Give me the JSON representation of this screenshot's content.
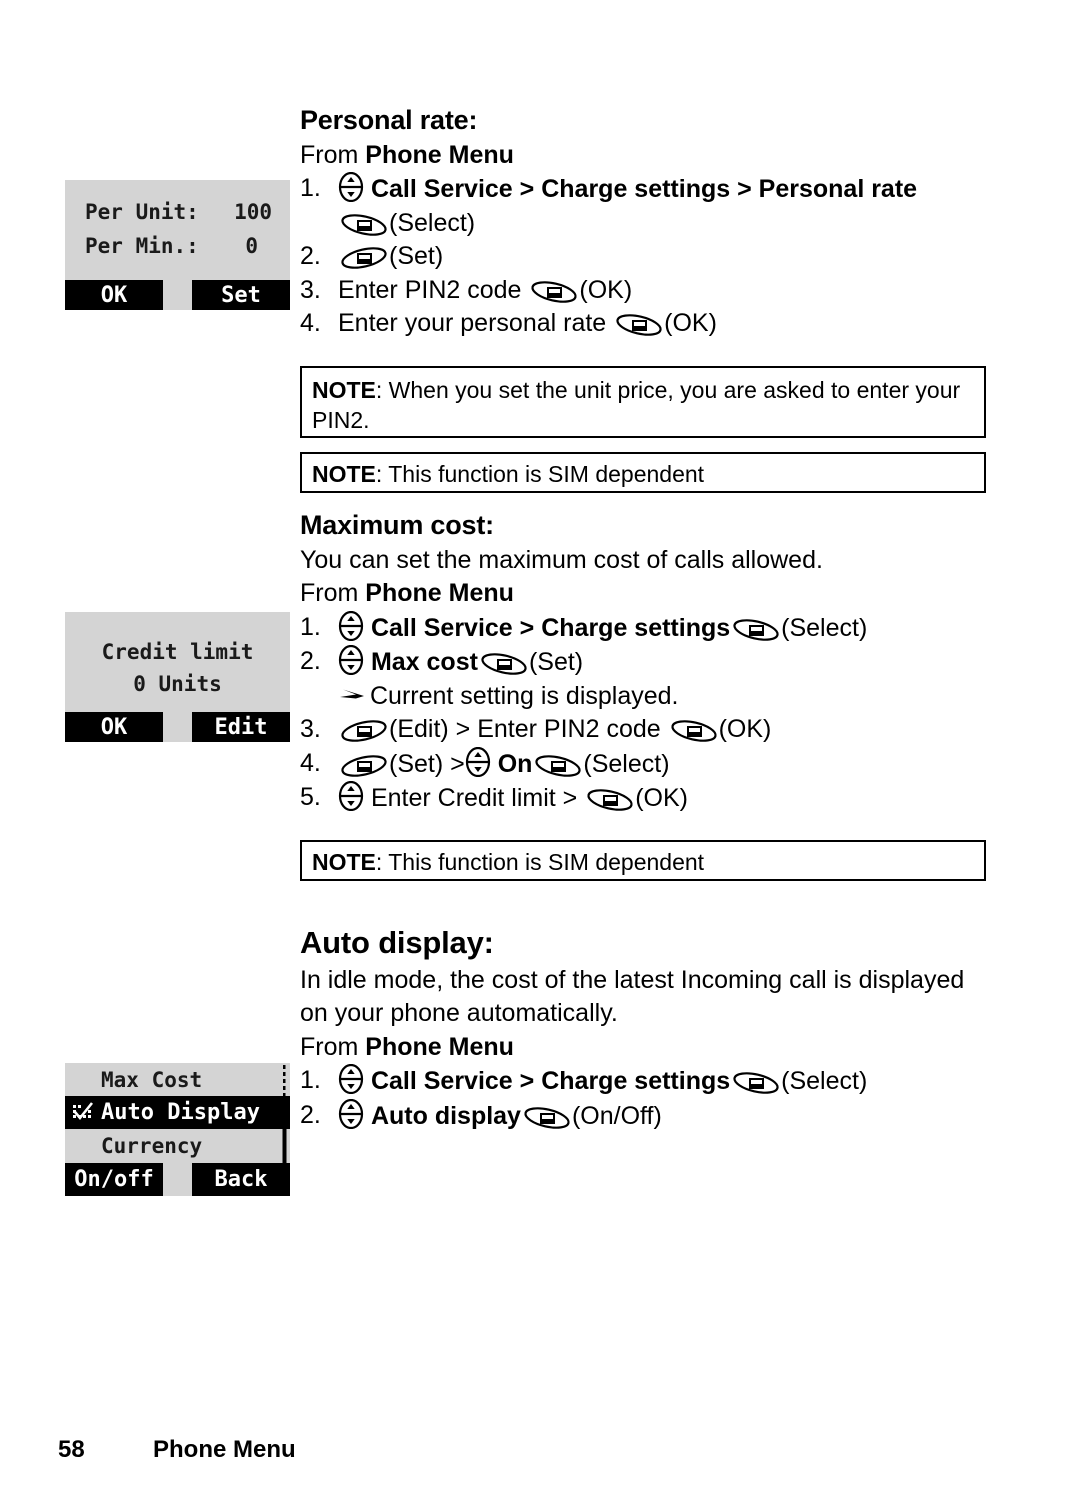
{
  "page": {
    "number": "58",
    "footer_title": "Phone Menu"
  },
  "sections": {
    "personal_rate": {
      "heading": "Personal rate:",
      "from_prefix": "From ",
      "from_bold": "Phone Menu",
      "steps": [
        {
          "num": "1.",
          "parts": "Call Service > Charge settings > Personal rate"
        },
        {
          "num": "",
          "parts": "(Select)"
        },
        {
          "num": "2.",
          "parts": "(Set)"
        },
        {
          "num": "3.",
          "parts": "Enter PIN2 code (OK)"
        },
        {
          "num": "4.",
          "parts": "Enter your personal rate (OK)"
        }
      ],
      "s1_a": "Call Service",
      "s1_gt1": " > ",
      "s1_b": "Charge settings",
      "s1_gt2": " > ",
      "s1_c": "Personal rate",
      "s1b_select": "(Select)",
      "s2_set": "(Set)",
      "s3_text": "Enter PIN2 code ",
      "s3_ok": "(OK)",
      "s4_text": "Enter your personal rate ",
      "s4_ok": "(OK)"
    },
    "note1": {
      "label": "NOTE",
      "text": ": When you set the unit price, you are asked to enter your PIN2."
    },
    "note2": {
      "label": "NOTE",
      "text": ": This function is SIM dependent"
    },
    "maximum_cost": {
      "heading": "Maximum cost:",
      "intro": "You can set the maximum cost of calls allowed.",
      "from_prefix": "From ",
      "from_bold": "Phone Menu",
      "s1_a": "Call Service",
      "s1_gt": " > ",
      "s1_b": "Charge settings",
      "s1_select": "(Select)",
      "s2_a": "Max cost",
      "s2_set": "(Set)",
      "s2_sub": "Current setting is displayed.",
      "s3_edit": "(Edit) > Enter PIN2 code ",
      "s3_ok": "(OK)",
      "s4_set": "(Set) >",
      "s4_on": "On",
      "s4_select": "(Select)",
      "s5_text": "Enter Credit limit > ",
      "s5_ok": "(OK)"
    },
    "note3": {
      "label": "NOTE",
      "text": ": This function is SIM dependent"
    },
    "auto_display": {
      "heading": "Auto display:",
      "intro_line1": "In idle mode, the cost of the latest Incoming call is displayed",
      "intro_line2": "on your phone automatically.",
      "from_prefix": "From ",
      "from_bold": "Phone Menu",
      "s1_a": "Call Service",
      "s1_gt": " > ",
      "s1_b": "Charge settings",
      "s1_select": "(Select)",
      "s2_a": "Auto display",
      "s2_onoff": "(On/Off)"
    }
  },
  "screens": {
    "personal_rate_screen": {
      "row1_label": "Per Unit:",
      "row1_value": "100",
      "row2_label": "Per Min.:",
      "row2_value": "0",
      "softkey_left": "OK",
      "softkey_right": "Set"
    },
    "credit_limit_screen": {
      "line1": "Credit limit",
      "line2": "0 Units",
      "softkey_left": "OK",
      "softkey_right": "Edit"
    },
    "charge_settings_screen": {
      "items": [
        {
          "label": "Max Cost",
          "checked": false,
          "selected": false
        },
        {
          "label": "Auto Display",
          "checked": true,
          "selected": true
        },
        {
          "label": "Currency",
          "checked": false,
          "selected": false,
          "nobox": true
        }
      ],
      "softkey_left": "On/off",
      "softkey_right": "Back"
    }
  },
  "colors": {
    "lcd_background": "#d4d4d4",
    "lcd_ink": "#1a1a1a",
    "softkey_background": "#000000",
    "softkey_text": "#ffffff",
    "page_background": "#ffffff"
  }
}
